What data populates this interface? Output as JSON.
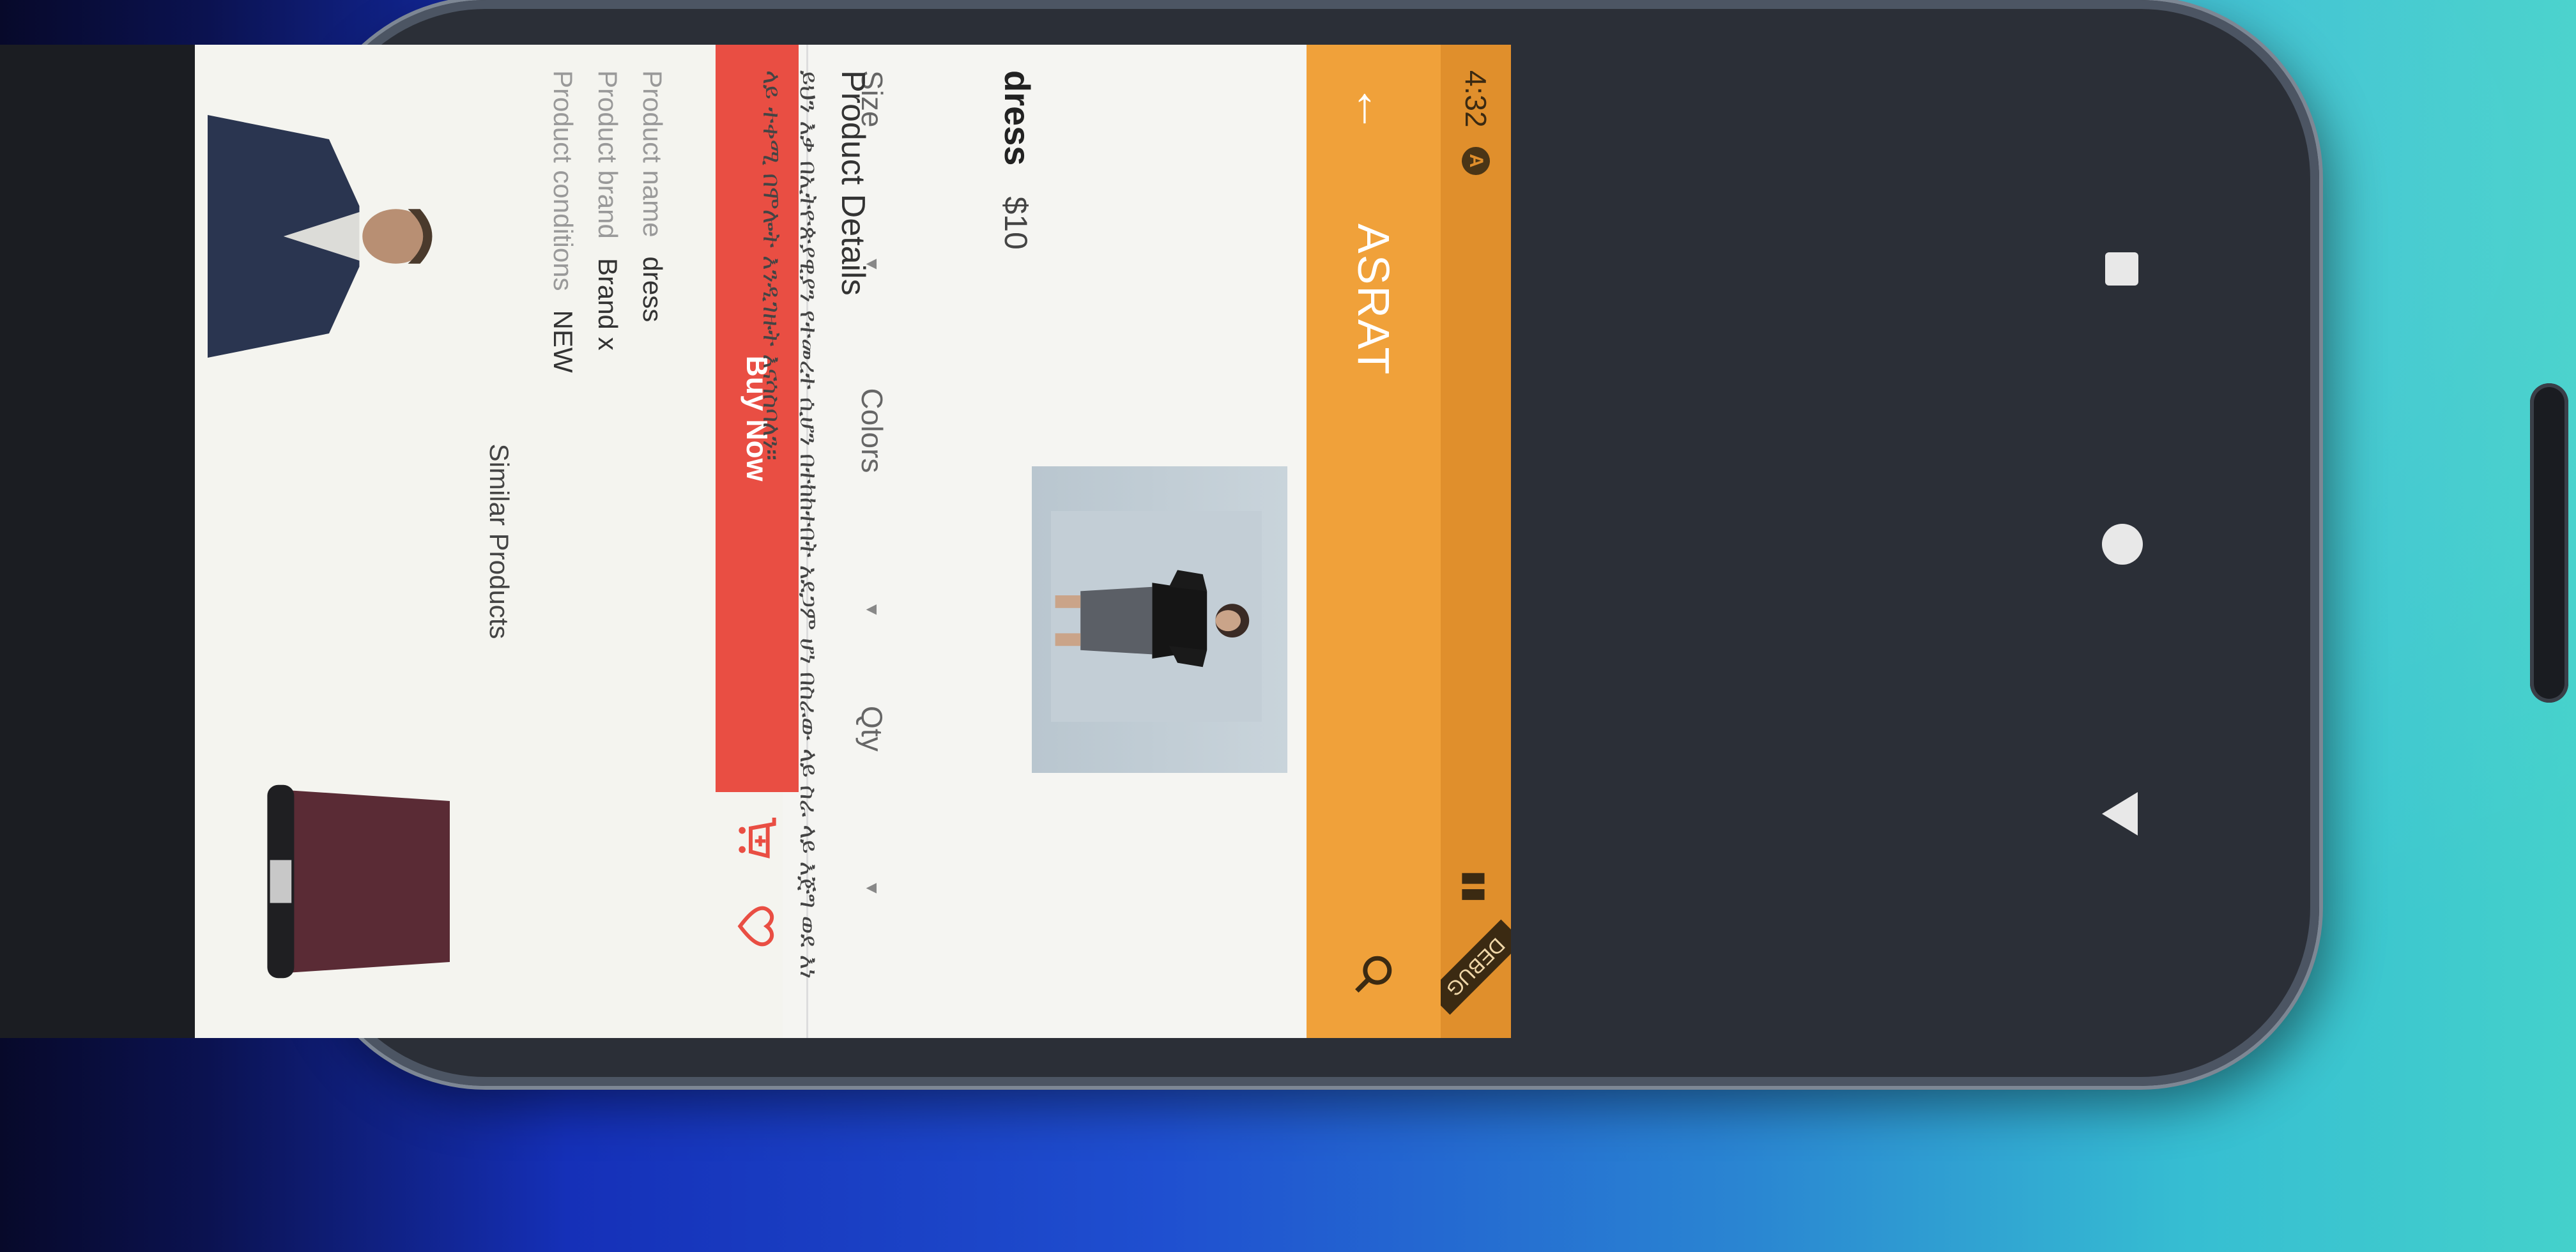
{
  "status_bar": {
    "time": "4:32",
    "debug_label": "DEBUG"
  },
  "app_bar": {
    "title": "ASRAT",
    "back_icon": "arrow-back-icon",
    "search_icon": "search-icon"
  },
  "product": {
    "name": "dress",
    "price": "$10"
  },
  "options": {
    "size_label": "Size",
    "colors_label": "Colors",
    "qty_label": "Qty"
  },
  "actions": {
    "buy_label": "Buy Now",
    "cart_icon": "add-to-cart-icon",
    "wishlist_icon": "heart-icon"
  },
  "details": {
    "title": "Product Details",
    "description": "ይህን እቃ በኢትዮጵያዊያን የተመረተ ሲሆን በተከከተበት አደጋም ሆነ በስራው ላይ ስራ ላይ እጅግ ወደ እነ ላይ ተቀሚ በሞሎት እንዲገዙት እናሳስባለን።"
  },
  "specs": [
    {
      "label": "Product name",
      "value": "dress"
    },
    {
      "label": "Product brand",
      "value": "Brand x"
    },
    {
      "label": "Product conditions",
      "value": "NEW"
    }
  ],
  "similar": {
    "title": "Similar Products"
  },
  "colors": {
    "app_bar": "#f0a13a",
    "status_bar": "#e08f2c",
    "buy_button": "#e94e43"
  }
}
